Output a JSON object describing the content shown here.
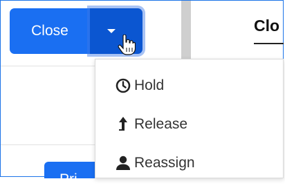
{
  "toolbar": {
    "close_label": "Close",
    "split_icon": "chevron-down-icon"
  },
  "tab": {
    "label": "Clo"
  },
  "menu": {
    "items": [
      {
        "label": "Hold",
        "icon": "clock-icon"
      },
      {
        "label": "Release",
        "icon": "arrow-up-icon"
      },
      {
        "label": "Reassign",
        "icon": "user-icon"
      }
    ]
  },
  "background_button": {
    "label_fragment": "Pri"
  },
  "colors": {
    "primary": "#1a6ff2",
    "primary_dark": "#0b56d1",
    "text": "#333333"
  }
}
